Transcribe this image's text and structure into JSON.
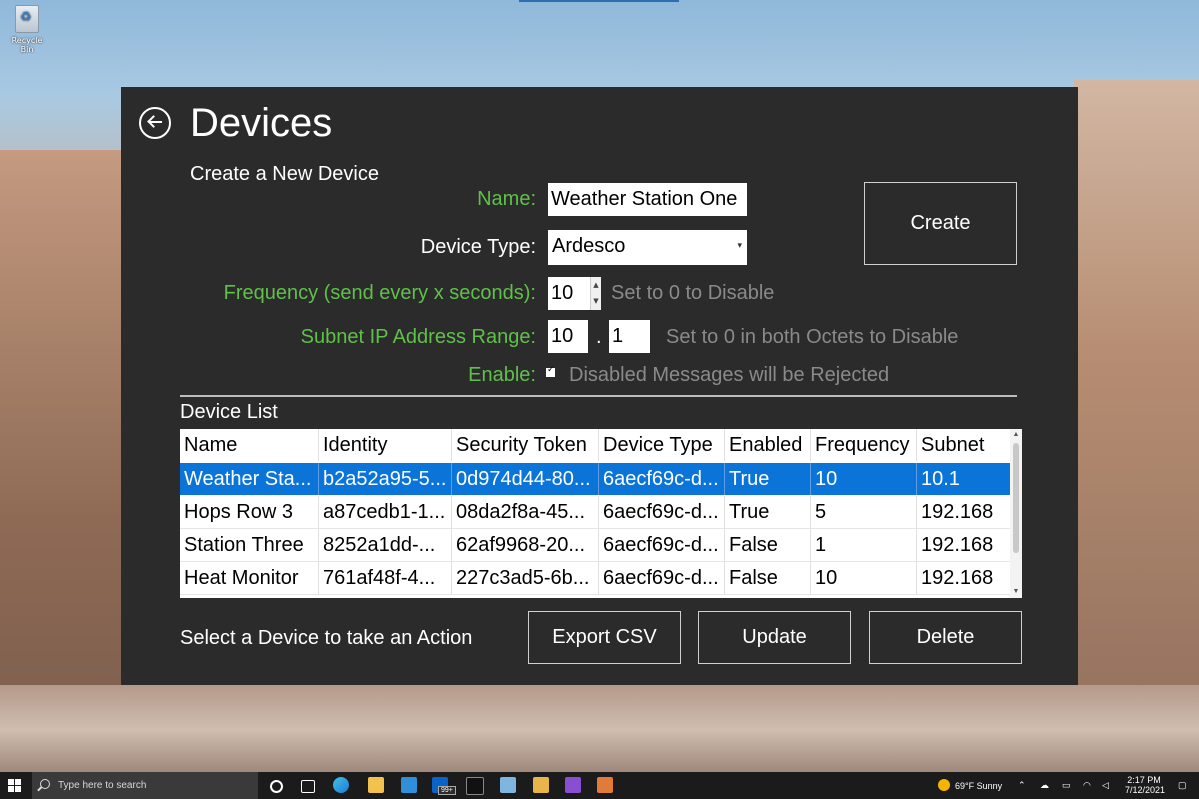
{
  "desktop": {
    "recycle_label": "Recycle Bin"
  },
  "window": {
    "title": "Devices",
    "subtitle": "Create a New Device",
    "form": {
      "name_label": "Name:",
      "name_value": "Weather Station One",
      "type_label": "Device Type:",
      "type_value": "Ardesco",
      "freq_label": "Frequency (send every x seconds):",
      "freq_value": "10",
      "freq_hint": "Set to 0 to Disable",
      "subnet_label": "Subnet IP Address Range:",
      "subnet_a": "10",
      "subnet_dot": ".",
      "subnet_b": "1",
      "subnet_hint": "Set to 0 in both Octets to Disable",
      "enable_label": "Enable:",
      "enable_checked": true,
      "enable_hint": "Disabled Messages will be Rejected"
    },
    "create_label": "Create",
    "list_label": "Device List",
    "columns": [
      "Name",
      "Identity",
      "Security Token",
      "Device Type",
      "Enabled",
      "Frequency",
      "Subnet"
    ],
    "rows": [
      [
        "Weather Sta...",
        "b2a52a95-5...",
        "0d974d44-80...",
        "6aecf69c-d...",
        "True",
        "10",
        "10.1"
      ],
      [
        "Hops Row 3",
        "a87cedb1-1...",
        "08da2f8a-45...",
        "6aecf69c-d...",
        "True",
        "5",
        "192.168"
      ],
      [
        "Station Three",
        "8252a1dd-...",
        "62af9968-20...",
        "6aecf69c-d...",
        "False",
        "1",
        "192.168"
      ],
      [
        "Heat Monitor",
        "761af48f-4...",
        "227c3ad5-6b...",
        "6aecf69c-d...",
        "False",
        "10",
        "192.168"
      ]
    ],
    "selected_row": 0,
    "status": "Select a Device to take an Action",
    "export_label": "Export CSV",
    "update_label": "Update",
    "delete_label": "Delete"
  },
  "taskbar": {
    "search_placeholder": "Type here to search",
    "badge": "99+",
    "weather": "69°F  Sunny",
    "time": "2:17 PM",
    "date": "7/12/2021"
  },
  "colors": {
    "selection": "#0a74d8",
    "label_green": "#5fc04a",
    "window_bg": "#2b2b2b"
  }
}
